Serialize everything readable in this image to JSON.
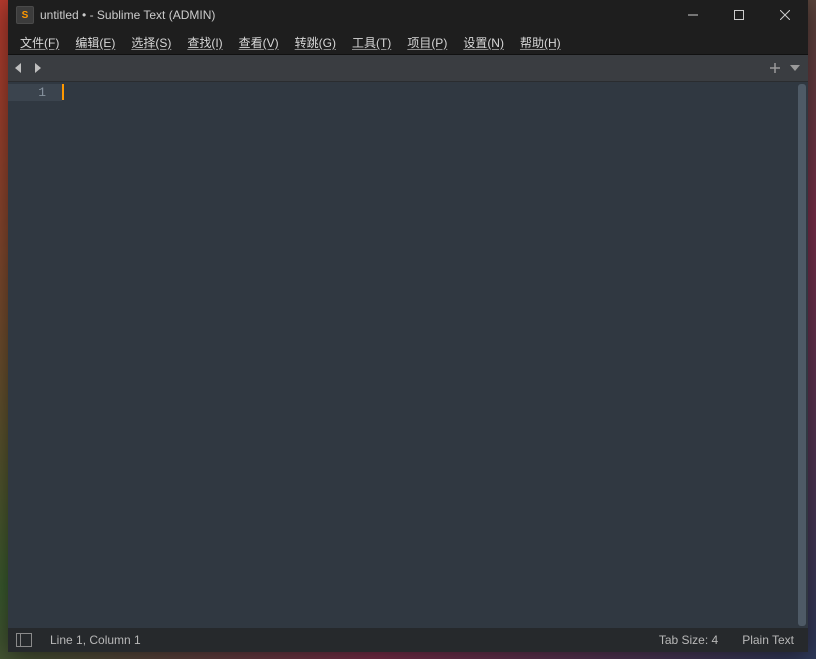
{
  "titlebar": {
    "icon_letter": "S",
    "title": "untitled • - Sublime Text (ADMIN)"
  },
  "menubar": {
    "items": [
      "文件(F)",
      "编辑(E)",
      "选择(S)",
      "查找(I)",
      "查看(V)",
      "转跳(G)",
      "工具(T)",
      "项目(P)",
      "设置(N)",
      "帮助(H)"
    ]
  },
  "editor": {
    "line_numbers": [
      "1"
    ]
  },
  "statusbar": {
    "position": "Line 1, Column 1",
    "tab_size": "Tab Size: 4",
    "syntax": "Plain Text"
  }
}
